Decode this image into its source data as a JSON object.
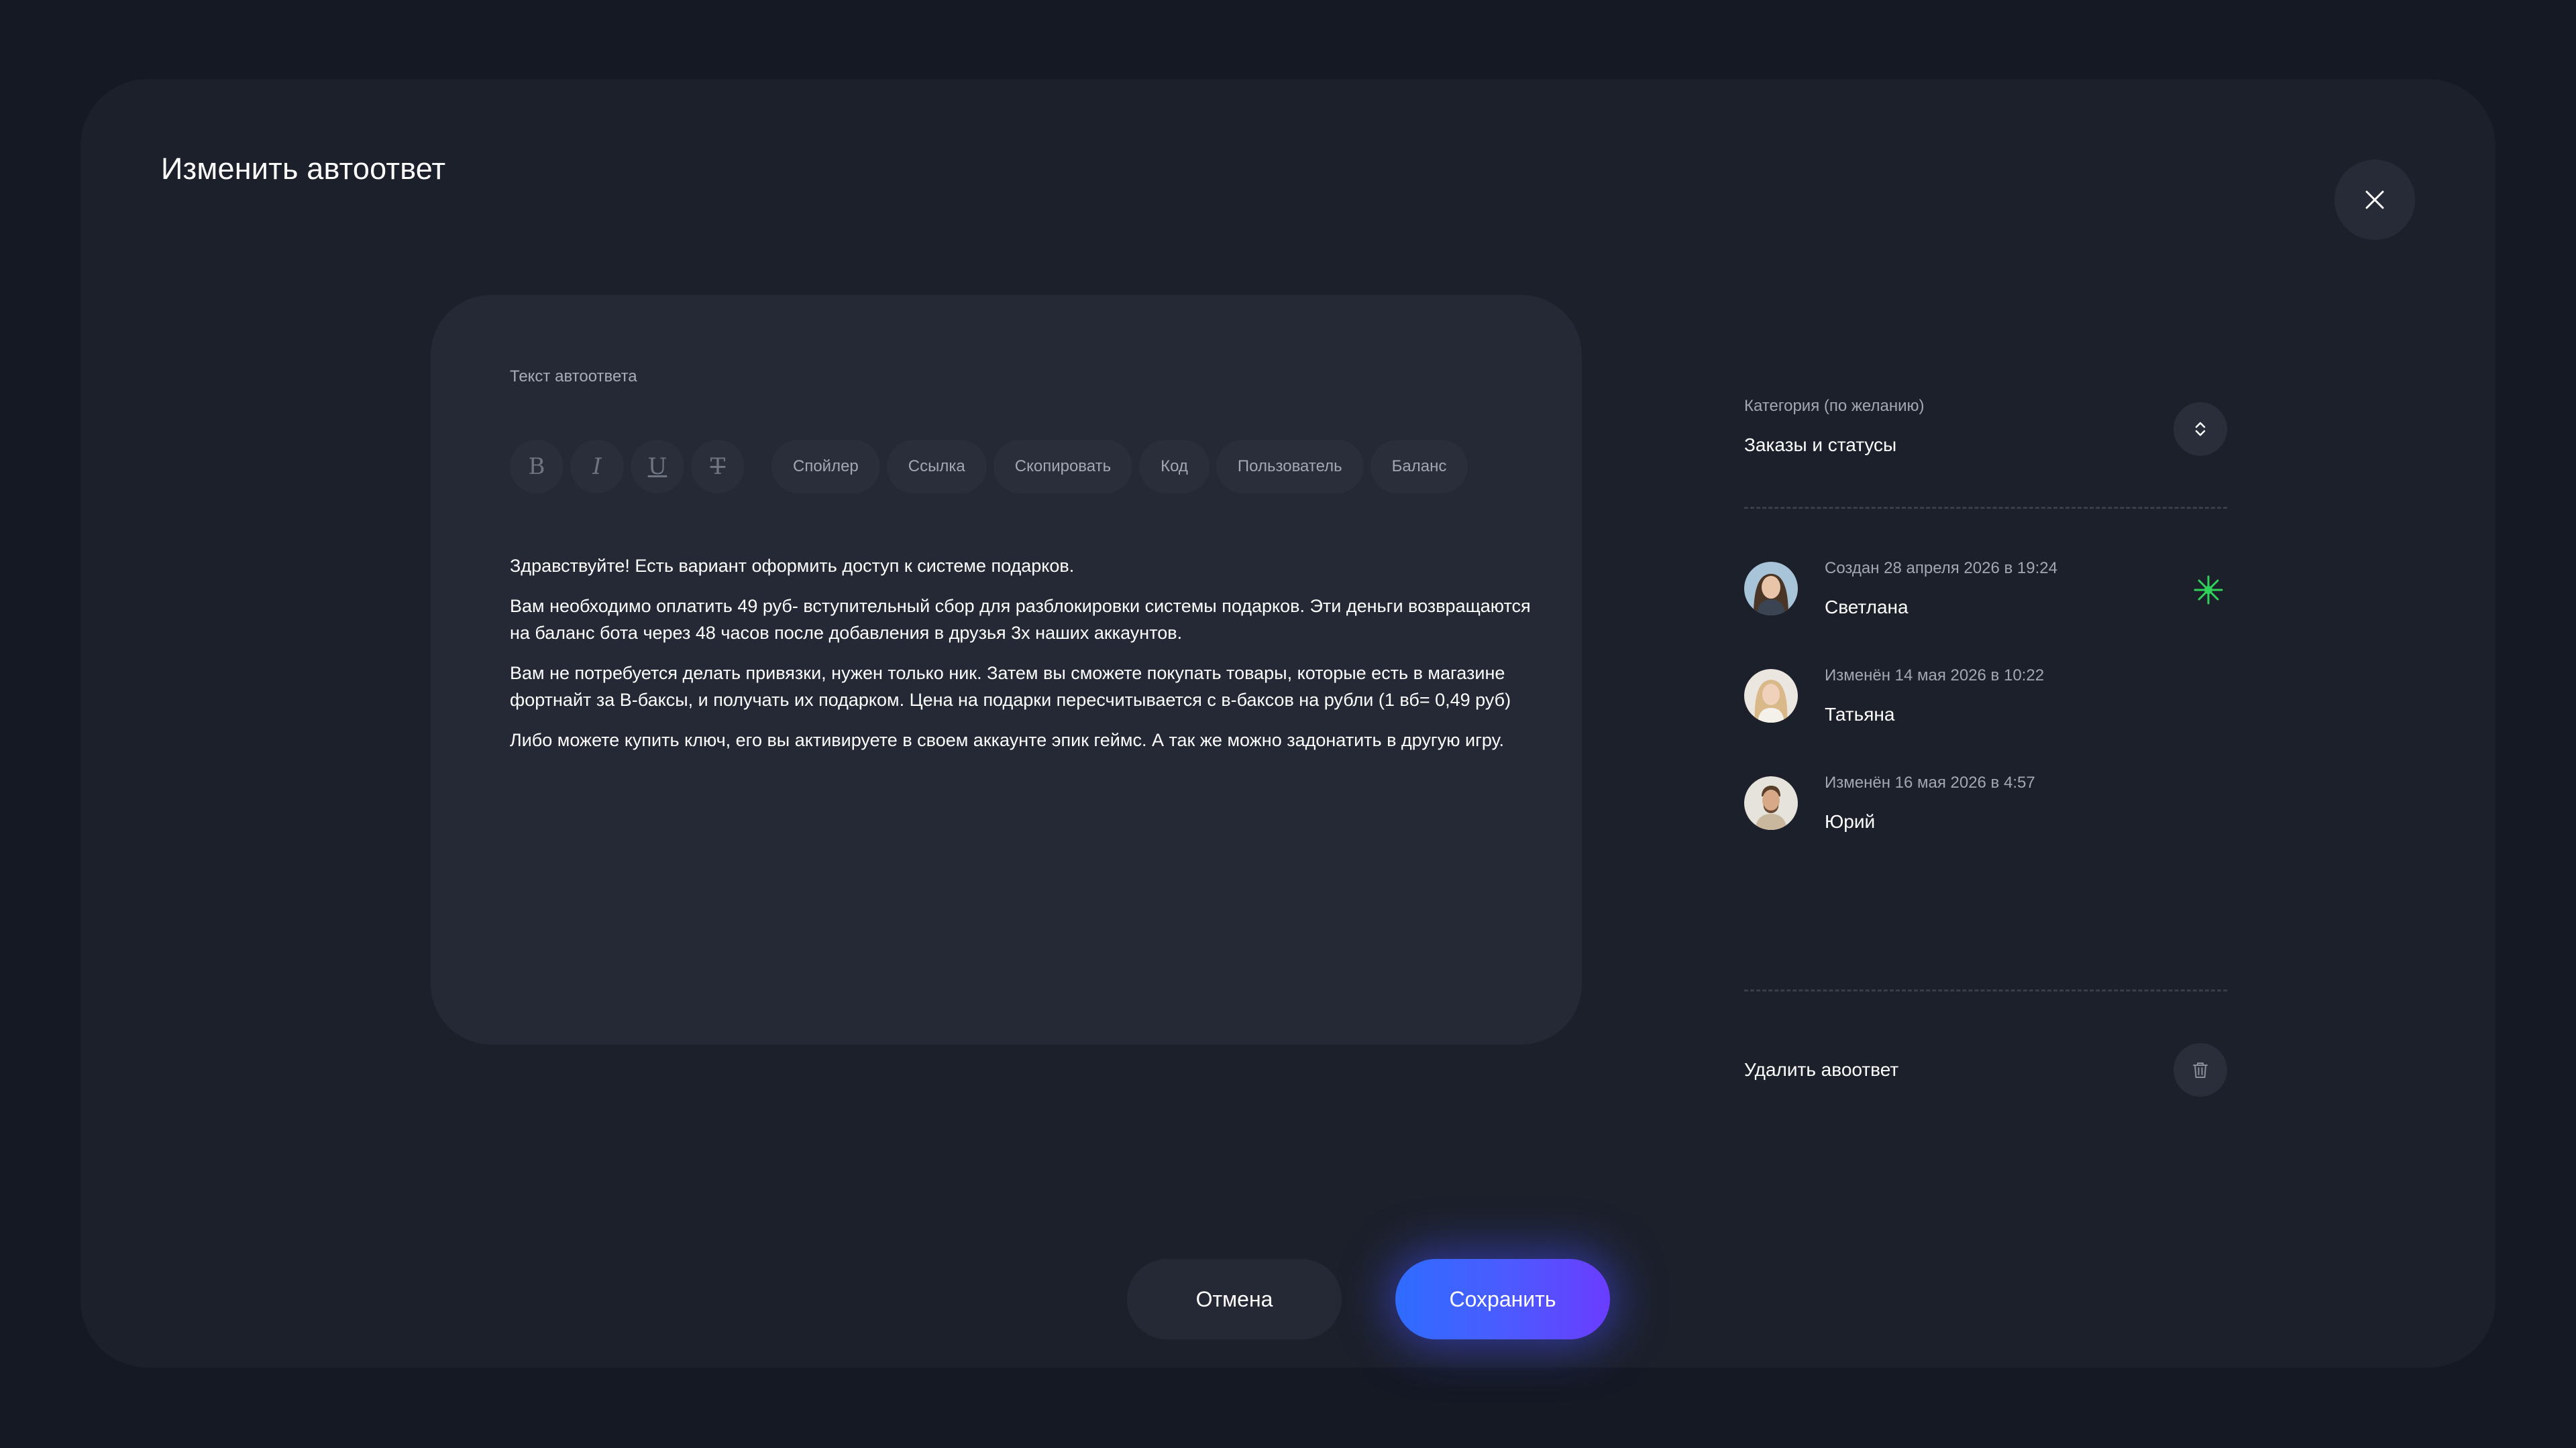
{
  "title": "Изменить автоответ",
  "close_icon": "close-icon",
  "editor": {
    "label": "Текст автоответа",
    "format_buttons": [
      {
        "glyph": "B",
        "icon": "bold-icon"
      },
      {
        "glyph": "I",
        "icon": "italic-icon"
      },
      {
        "glyph": "U",
        "icon": "underline-icon"
      },
      {
        "glyph": "T",
        "icon": "strikethrough-icon"
      }
    ],
    "insert_buttons": [
      "Спойлер",
      "Ссылка",
      "Скопировать",
      "Код",
      "Пользователь",
      "Баланс"
    ],
    "paragraphs": [
      "Здравствуйте! Есть вариант оформить доступ к системе подарков.",
      "Вам необходимо оплатить 49 руб- вступительный сбор для разблокировки системы подарков. Эти деньги возвращаются на баланс бота через 48 часов после добавления в друзья 3х наших аккаунтов.",
      "Вам не потребуется делать привязки, нужен только ник. Затем вы сможете покупать товары, которые есть в магазине фортнайт за В-баксы, и получать их подарком. Цена на подарки пересчитывается с в-баксов на рубли (1 вб= 0,49 руб)",
      "Либо можете купить ключ, его вы активируете в своем аккаунте эпик геймс. А так же можно задонатить в другую игру."
    ]
  },
  "category": {
    "label": "Категория (по желанию)",
    "value": "Заказы и статусы",
    "icon": "chevron-updown-icon"
  },
  "history": [
    {
      "date": "Создан 28 апреля 2026 в 19:24",
      "name": "Светлана",
      "badge_icon": "spark-icon",
      "badge_color": "#2fd15a"
    },
    {
      "date": "Изменён 14 мая 2026 в 10:22",
      "name": "Татьяна"
    },
    {
      "date": "Изменён 16 мая 2026 в 4:57",
      "name": "Юрий"
    }
  ],
  "delete": {
    "label": "Удалить авоответ",
    "icon": "trash-icon"
  },
  "actions": {
    "cancel": "Отмена",
    "save": "Сохранить"
  },
  "colors": {
    "background": "#151924",
    "modal": "#1c202b",
    "card": "#252935",
    "accent_start": "#2f6cff",
    "accent_end": "#6a3cff"
  }
}
